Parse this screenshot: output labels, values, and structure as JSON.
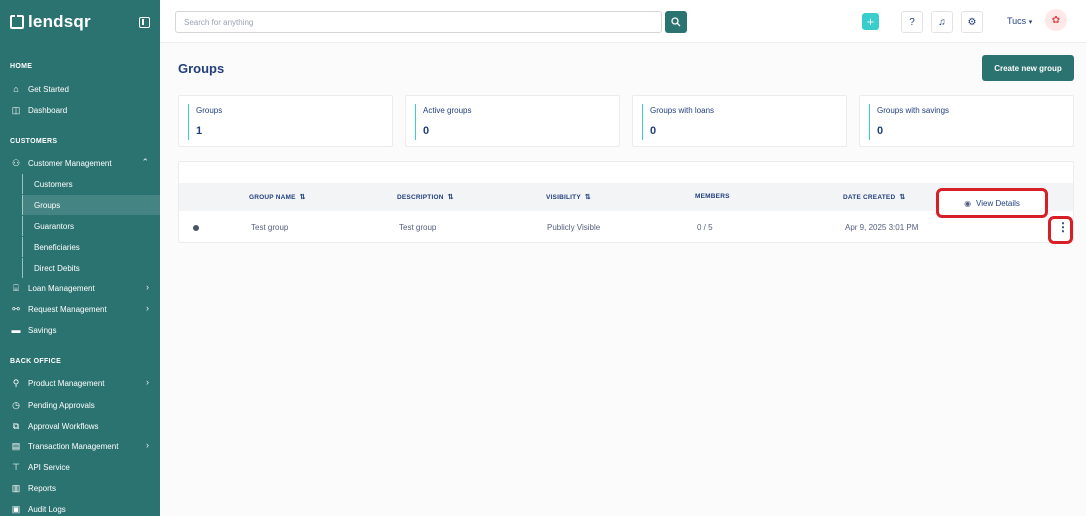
{
  "brand": {
    "logo_text": "lendsqr"
  },
  "sidebar": {
    "sections": {
      "home": "HOME",
      "customers": "CUSTOMERS",
      "back_office": "BACK OFFICE"
    },
    "home_items": [
      {
        "label": "Get Started",
        "icon": "home-icon"
      },
      {
        "label": "Dashboard",
        "icon": "dashboard-icon"
      }
    ],
    "customer_management": {
      "label": "Customer Management",
      "icon": "users-icon"
    },
    "customer_sub_items": [
      {
        "label": "Customers",
        "active": false
      },
      {
        "label": "Groups",
        "active": true
      },
      {
        "label": "Guarantors",
        "active": false
      },
      {
        "label": "Beneficiaries",
        "active": false
      },
      {
        "label": "Direct Debits",
        "active": false
      }
    ],
    "customer_items": [
      {
        "label": "Loan Management",
        "icon": "bank-icon"
      },
      {
        "label": "Request Management",
        "icon": "request-icon"
      },
      {
        "label": "Savings",
        "icon": "savings-icon"
      }
    ],
    "back_office_items": [
      {
        "label": "Product Management",
        "icon": "product-icon"
      },
      {
        "label": "Pending Approvals",
        "icon": "clock-icon"
      },
      {
        "label": "Approval Workflows",
        "icon": "workflow-icon"
      },
      {
        "label": "Transaction Management",
        "icon": "transaction-icon"
      },
      {
        "label": "API Service",
        "icon": "api-icon"
      },
      {
        "label": "Reports",
        "icon": "report-icon"
      },
      {
        "label": "Audit Logs",
        "icon": "audit-icon"
      }
    ]
  },
  "header": {
    "search_placeholder": "Search for anything",
    "user_name": "Tucs"
  },
  "page": {
    "title": "Groups",
    "create_button": "Create new group"
  },
  "stats": [
    {
      "label": "Groups",
      "value": "1"
    },
    {
      "label": "Active groups",
      "value": "0"
    },
    {
      "label": "Groups with loans",
      "value": "0"
    },
    {
      "label": "Groups with savings",
      "value": "0"
    }
  ],
  "table": {
    "columns": [
      "GROUP NAME",
      "DESCRIPTION",
      "VISIBILITY",
      "MEMBERS",
      "DATE CREATED"
    ],
    "rows": [
      {
        "name": "Test group",
        "description": "Test group",
        "visibility": "Publicly Visible",
        "members": "0 / 5",
        "date_created": "Apr 9, 2025 3:01 PM"
      }
    ]
  },
  "row_menu": {
    "view_details": "View Details"
  },
  "colors": {
    "sidebar": "#2b7371",
    "accent": "#39cdcc",
    "text": "#213f7d",
    "highlight": "#d91f26"
  }
}
